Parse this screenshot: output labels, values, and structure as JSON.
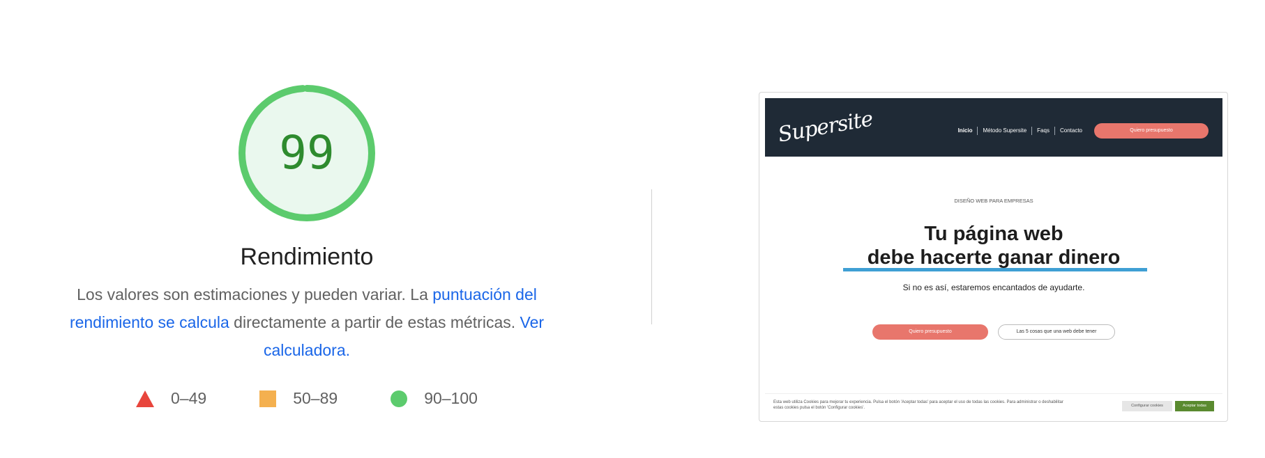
{
  "score": {
    "value": "99",
    "fraction": 0.99,
    "title": "Rendimiento",
    "desc_before": "Los valores son estimaciones y pueden variar. La ",
    "link_score": "puntuación del rendimiento se calcula",
    "desc_middle": " directamente a partir de estas métricas. ",
    "link_calculator": "Ver calculadora.",
    "colors": {
      "pass": "#5ccb6d",
      "pass_bg": "#eaf8ee",
      "pass_text": "#2e8b2e",
      "link": "#1a66e8"
    }
  },
  "legend": [
    {
      "icon": "triangle-icon",
      "label": "0–49",
      "color": "#e8453c"
    },
    {
      "icon": "square-icon",
      "label": "50–89",
      "color": "#f4b04f"
    },
    {
      "icon": "circle-icon",
      "label": "90–100",
      "color": "#5ccb6d"
    }
  ],
  "thumbnail": {
    "logo": "Supersite",
    "nav": [
      "Inicio",
      "Método Supersite",
      "Faqs",
      "Contacto"
    ],
    "nav_cta": "Quiero presupuesto",
    "eyebrow": "DISEÑO WEB PARA EMPRESAS",
    "headline_1": "Tu página web",
    "headline_2": "debe hacerte ganar dinero",
    "subheadline": "Si no es así, estaremos encantados de ayudarte.",
    "btn_primary": "Quiero presupuesto",
    "btn_secondary": "Las 5 cosas que una web debe tener",
    "cookie_text": "Esta web utiliza Cookies para mejorar tu experiencia. Pulsa el botón 'Aceptar todas' para aceptar el uso de todas las cookies. Para administrar o deshabilitar estas cookies pulsa el botón 'Configurar cookies'.",
    "cookie_config": "Configurar cookies",
    "cookie_accept": "Aceptar todas",
    "colors": {
      "header_bg": "#1f2a36",
      "cta": "#e8766c",
      "underline": "#3f9fd4",
      "accept": "#5a8a2f"
    }
  }
}
